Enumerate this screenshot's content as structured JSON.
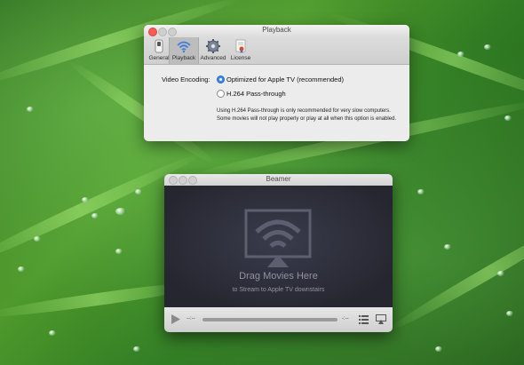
{
  "preferences_window": {
    "title": "Playback",
    "tabs": [
      {
        "label": "General",
        "icon": "switch-icon"
      },
      {
        "label": "Playback",
        "icon": "wifi-icon",
        "selected": true
      },
      {
        "label": "Advanced",
        "icon": "gear-icon"
      },
      {
        "label": "License",
        "icon": "certificate-icon"
      }
    ],
    "video_encoding": {
      "label": "Video Encoding:",
      "options": [
        {
          "label": "Optimized for Apple TV (recommended)",
          "selected": true
        },
        {
          "label": "H.264 Pass-through",
          "selected": false
        }
      ],
      "note": "Using H.264 Pass-through is only recommended for very slow computers. Some movies will not play properly or play at all when this option is enabled."
    }
  },
  "beamer_window": {
    "title": "Beamer",
    "drop_title": "Drag Movies Here",
    "drop_subtitle": "to Stream to Apple TV downstairs",
    "time_elapsed": "--:--",
    "time_remaining": "-:--",
    "controls": [
      "play-icon",
      "playlist-icon",
      "airplay-icon"
    ]
  },
  "colors": {
    "accent": "#3a8af0",
    "close": "#fc5b57",
    "wallpaper": "#3f8a27"
  }
}
